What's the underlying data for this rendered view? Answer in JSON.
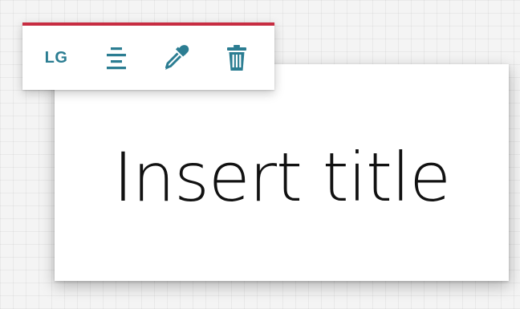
{
  "toolbar": {
    "size_label": "LG",
    "align_icon": "align-center-icon",
    "color_icon": "eyedropper-icon",
    "delete_icon": "trash-icon",
    "accent_color": "#c72c41",
    "icon_color": "#2b7d92"
  },
  "content": {
    "title": "Insert title"
  }
}
